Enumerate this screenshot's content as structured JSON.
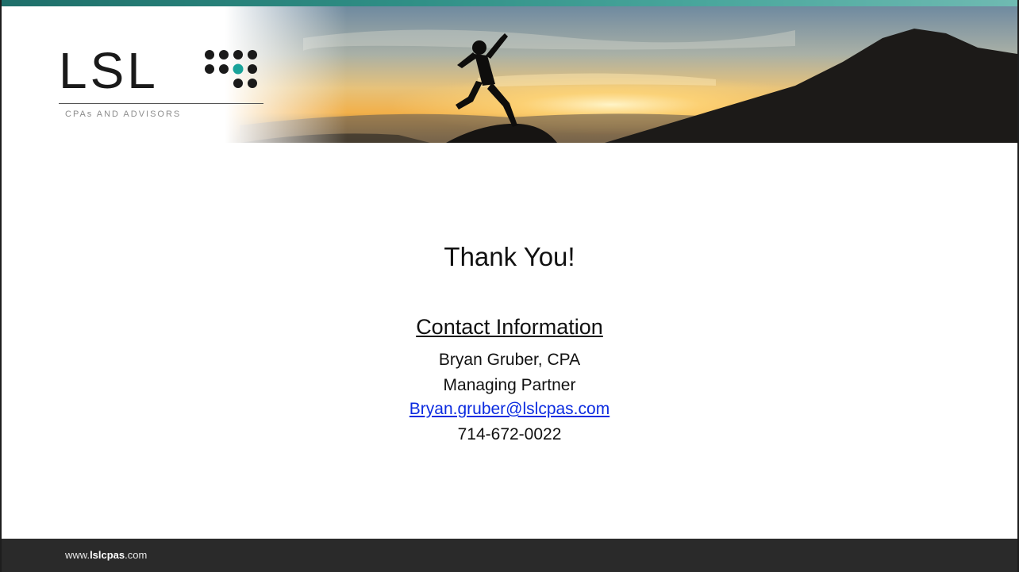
{
  "header": {
    "logo_letters": "LSL",
    "logo_subtitle": "CPAs AND ADVISORS"
  },
  "main": {
    "thank_you": "Thank You!",
    "contact_heading": "Contact Information",
    "name": "Bryan Gruber, CPA",
    "title": "Managing Partner",
    "email": "Bryan.gruber@lslcpas.com",
    "phone": "714-672-0022"
  },
  "footer": {
    "url_prefix": "www.",
    "url_domain": "lslcpas",
    "url_suffix": ".com"
  },
  "colors": {
    "accent_teal": "#2f8f86",
    "dot_teal": "#1aa39a",
    "footer_bg": "#2a2a2a",
    "link": "#0b2be0"
  }
}
